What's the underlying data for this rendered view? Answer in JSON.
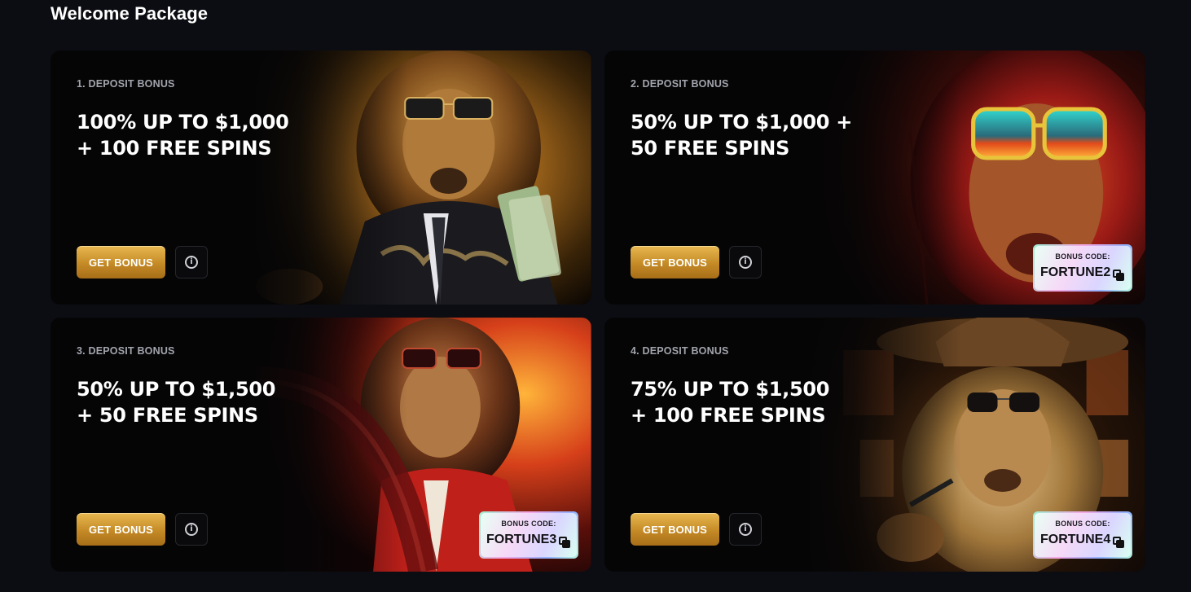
{
  "page": {
    "title": "Welcome Package"
  },
  "colors": {
    "background": "#0c0d12",
    "button_gold": "#c48a26",
    "kicker_gray": "#a3a5ad"
  },
  "cards": [
    {
      "kicker": "1. DEPOSIT BONUS",
      "headline_line1": "100% UP TO $1,000",
      "headline_line2": "+ 100 FREE SPINS",
      "button_label": "GET BONUS",
      "info_icon": "info-icon",
      "theme": "gold"
    },
    {
      "kicker": "2. DEPOSIT BONUS",
      "headline_line1": "50% UP TO $1,000 +",
      "headline_line2": "50 FREE SPINS",
      "button_label": "GET BONUS",
      "info_icon": "info-icon",
      "code_label": "BONUS CODE:",
      "code_value": "FORTUNE2",
      "theme": "red"
    },
    {
      "kicker": "3. DEPOSIT BONUS",
      "headline_line1": "50% UP TO $1,500",
      "headline_line2": "+ 50 FREE SPINS",
      "button_label": "GET BONUS",
      "info_icon": "info-icon",
      "code_label": "BONUS CODE:",
      "code_value": "FORTUNE3",
      "theme": "fire"
    },
    {
      "kicker": "4. DEPOSIT BONUS",
      "headline_line1": "75% UP TO $1,500",
      "headline_line2": "+ 100 FREE SPINS",
      "button_label": "GET BONUS",
      "info_icon": "info-icon",
      "code_label": "BONUS CODE:",
      "code_value": "FORTUNE4",
      "theme": "night"
    }
  ]
}
